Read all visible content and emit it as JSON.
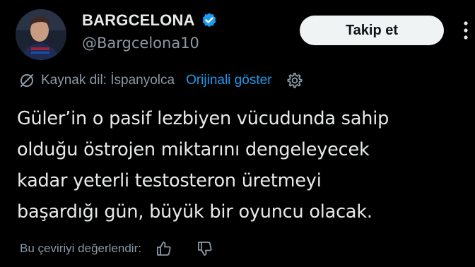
{
  "author": {
    "display_name": "BARGCELONA",
    "handle": "@Bargcelona10",
    "verified": true
  },
  "follow_button": {
    "label": "Takip et"
  },
  "translation": {
    "source_label": "Kaynak dil: İspanyolca",
    "show_original_label": "Orijinali göster"
  },
  "tweet": {
    "lines": [
      "Güler’in o pasif lezbiyen vücudunda sahip",
      "olduğu östrojen miktarını dengeleyecek",
      "kadar yeterli testosteron üretmeyi",
      "başardığı gün, büyük bir oyuncu olacak."
    ]
  },
  "rating": {
    "prompt": "Bu çeviriyi değerlendir:"
  },
  "icons": {
    "verified": "verified-badge-icon",
    "more": "more-vertical-icon",
    "translate": "translate-icon",
    "settings": "gear-icon",
    "like": "thumbs-up-icon",
    "dislike": "thumbs-down-icon"
  },
  "colors": {
    "background": "#000000",
    "text_primary": "#e7e9ea",
    "text_secondary": "#8b98a5",
    "link": "#1d9bf0",
    "verified": "#1d9bf0",
    "button_bg": "#eff3f4"
  }
}
